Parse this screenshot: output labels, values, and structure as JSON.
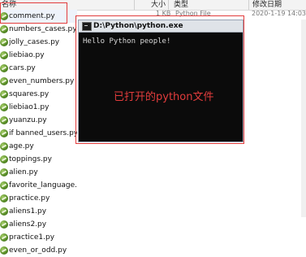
{
  "header": {
    "name": "名称",
    "size": "大小",
    "type": "类型",
    "modified": "修改日期"
  },
  "first_row": {
    "name": "comment.py",
    "size": "1 KB",
    "type": "Python File",
    "modified": "2020-1-19 14:03"
  },
  "files": [
    "numbers_cases.py",
    "jolly_cases.py",
    "liebiao.py",
    "cars.py",
    "even_numbers.py",
    "squares.py",
    "liebiao1.py",
    "yuanzu.py",
    "if banned_users.py",
    "age.py",
    "toppings.py",
    "alien.py",
    "favorite_language.py",
    "practice.py",
    "aliens1.py",
    "aliens2.py",
    "practice1.py",
    "even_or_odd.py"
  ],
  "console": {
    "title": "D:\\Python\\python.exe",
    "output": "Hello Python people!"
  },
  "annotation": "已打开的python文件",
  "colors": {
    "annotation": "#e23c3c",
    "console_bg": "#0b0b0b",
    "console_text": "#d9d9d9",
    "icon": "#5a8f28"
  }
}
